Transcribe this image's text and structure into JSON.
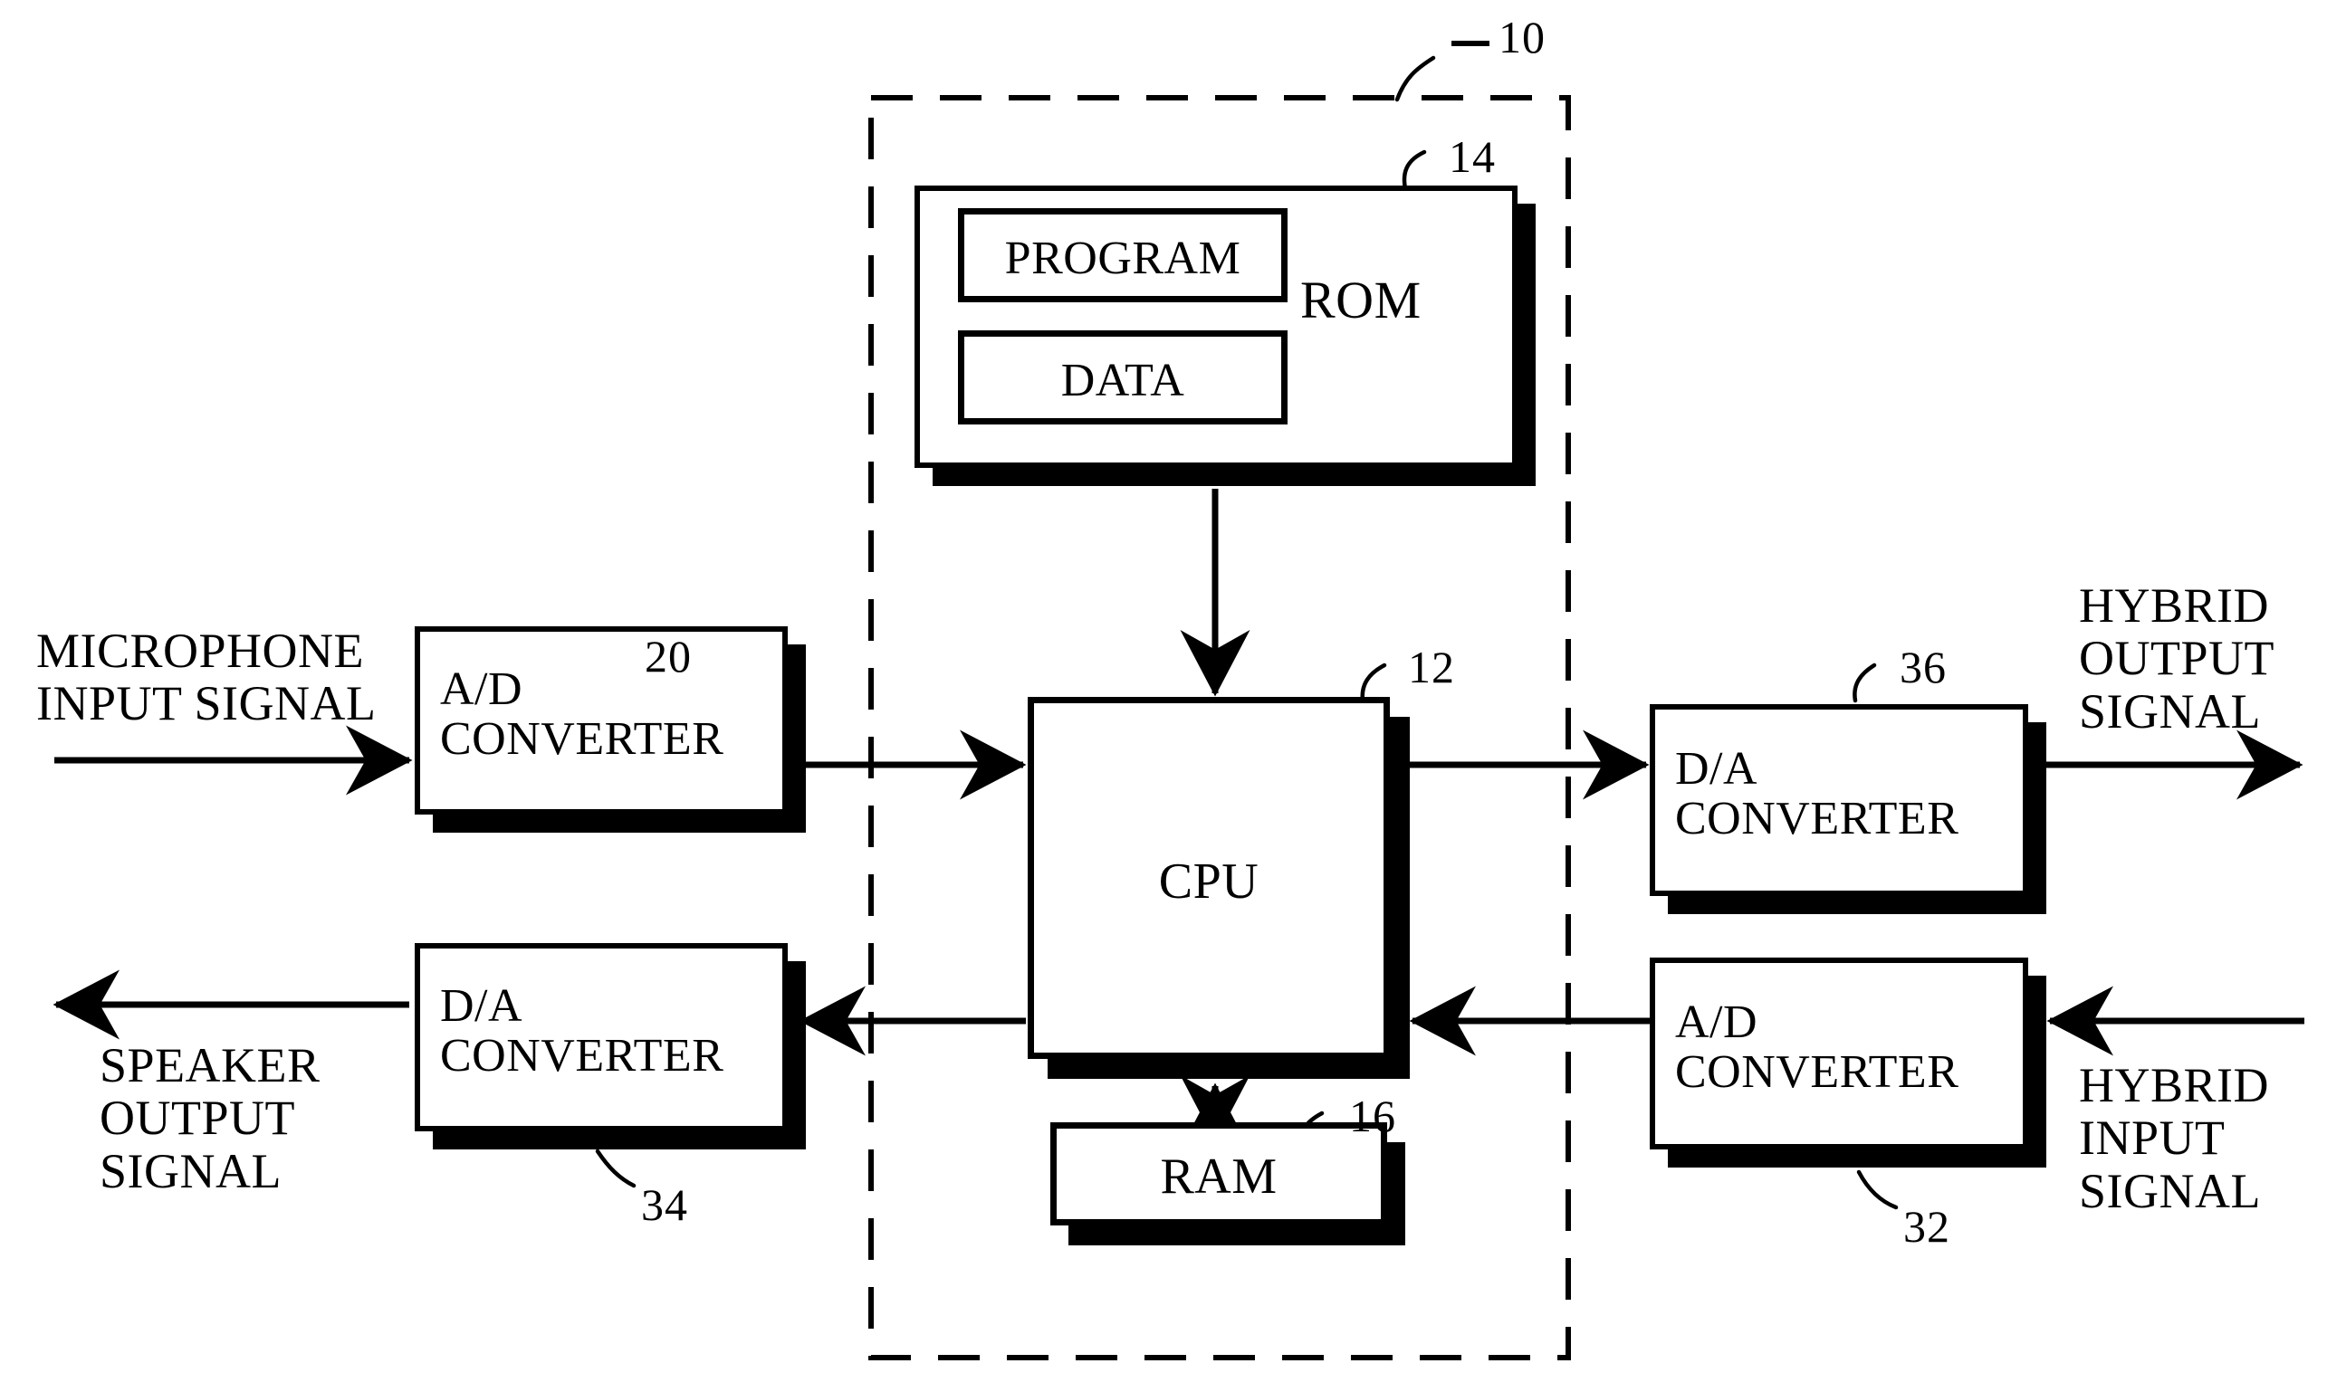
{
  "figure": {
    "type": "patent-block-diagram",
    "description": "Digital signal processing system block diagram"
  },
  "system": {
    "boundary_label": "10",
    "boundary_style": "dashed"
  },
  "blocks": [
    {
      "id": "rom",
      "label": "ROM",
      "ref": "14"
    },
    {
      "id": "program",
      "label": "PROGRAM",
      "ref": ""
    },
    {
      "id": "data",
      "label": "DATA",
      "ref": ""
    },
    {
      "id": "cpu",
      "label": "CPU",
      "ref": "12"
    },
    {
      "id": "ram",
      "label": "RAM",
      "ref": "16"
    },
    {
      "id": "adc_in",
      "label": "A/D\nCONVERTER",
      "ref": "20"
    },
    {
      "id": "dac_out",
      "label": "D/A\nCONVERTER",
      "ref": "34"
    },
    {
      "id": "dac_hyb",
      "label": "D/A\nCONVERTER",
      "ref": "36"
    },
    {
      "id": "adc_hyb",
      "label": "A/D\nCONVERTER",
      "ref": "32"
    }
  ],
  "signals": {
    "microphone_input": "MICROPHONE\nINPUT SIGNAL",
    "speaker_output": "SPEAKER\nOUTPUT\nSIGNAL",
    "hybrid_output": "HYBRID\nOUTPUT\nSIGNAL",
    "hybrid_input": "HYBRID\nINPUT\nSIGNAL"
  },
  "refnums": {
    "system": "10",
    "rom": "14",
    "cpu": "12",
    "ram": "16",
    "adc_in": "20",
    "dac_out": "34",
    "dac_hyb": "36",
    "adc_hyb": "32"
  },
  "colors": {
    "ink": "#000000",
    "paper": "#ffffff"
  }
}
